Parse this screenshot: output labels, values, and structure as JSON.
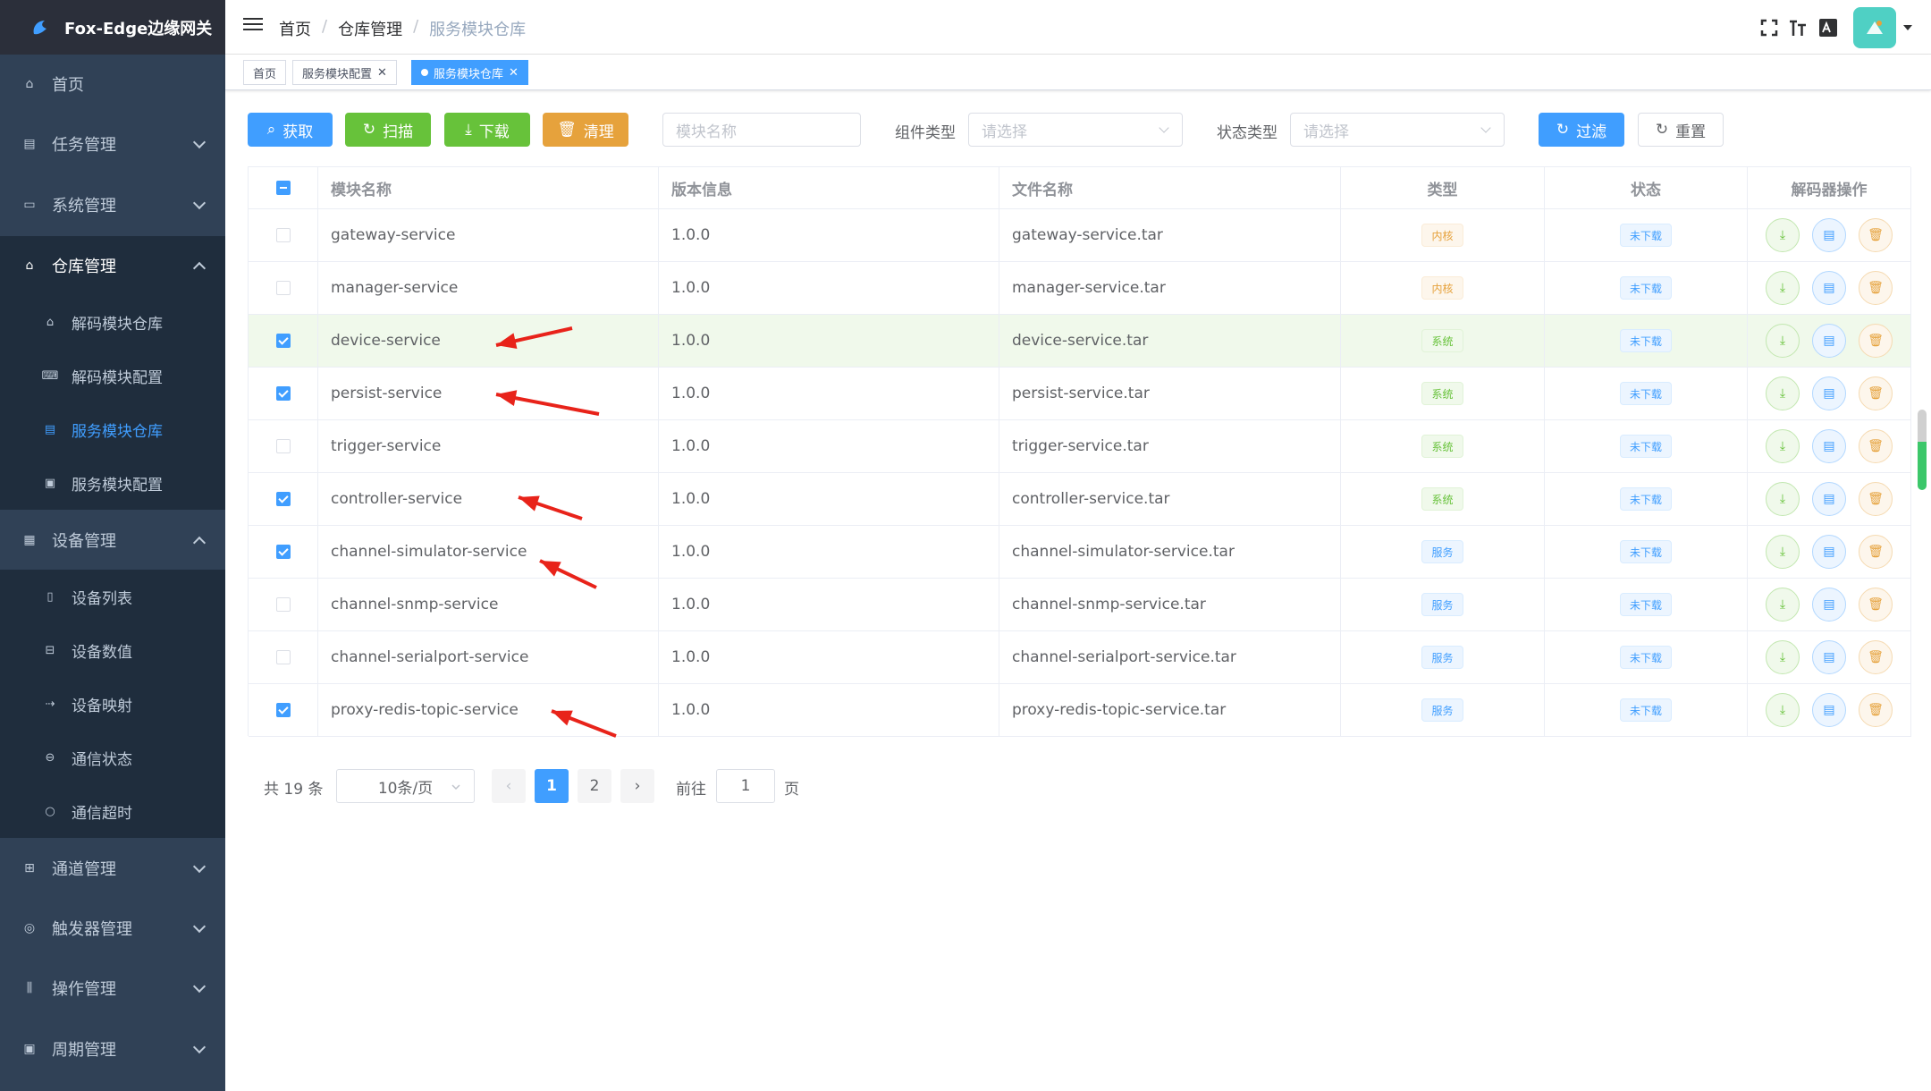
{
  "app": {
    "title": "Fox-Edge边缘网关"
  },
  "sidebar": {
    "items": [
      {
        "label": "首页",
        "icon": "home-icon"
      },
      {
        "label": "任务管理",
        "icon": "task-icon"
      },
      {
        "label": "系统管理",
        "icon": "system-icon"
      },
      {
        "label": "仓库管理",
        "icon": "repo-icon"
      },
      {
        "label": "设备管理",
        "icon": "device-icon"
      },
      {
        "label": "通道管理",
        "icon": "channel-icon"
      },
      {
        "label": "触发器管理",
        "icon": "trigger-icon"
      },
      {
        "label": "操作管理",
        "icon": "operate-icon"
      },
      {
        "label": "周期管理",
        "icon": "period-icon"
      }
    ],
    "repo_sub": [
      {
        "label": "解码模块仓库",
        "icon": "home-icon"
      },
      {
        "label": "解码模块配置",
        "icon": "keyboard-icon"
      },
      {
        "label": "服务模块仓库",
        "icon": "document-icon"
      },
      {
        "label": "服务模块配置",
        "icon": "config-icon"
      }
    ],
    "device_sub": [
      {
        "label": "设备列表",
        "icon": "phone-icon"
      },
      {
        "label": "设备数值",
        "icon": "data-icon"
      },
      {
        "label": "设备映射",
        "icon": "mapping-icon"
      },
      {
        "label": "通信状态",
        "icon": "status-icon"
      },
      {
        "label": "通信超时",
        "icon": "timeout-icon"
      }
    ]
  },
  "navbar": {
    "breadcrumb": [
      "首页",
      "仓库管理",
      "服务模块仓库"
    ],
    "tools": [
      "fullscreen-icon",
      "font-size-icon",
      "language-icon"
    ]
  },
  "tags": [
    {
      "label": "首页",
      "closable": false,
      "active": false
    },
    {
      "label": "服务模块配置",
      "closable": true,
      "active": false
    },
    {
      "label": "服务模块仓库",
      "closable": true,
      "active": true
    }
  ],
  "toolbar": {
    "fetch_label": "获取",
    "scan_label": "扫描",
    "download_label": "下载",
    "clean_label": "清理",
    "module_name_placeholder": "模块名称",
    "component_type_label": "组件类型",
    "component_type_placeholder": "请选择",
    "status_type_label": "状态类型",
    "status_type_placeholder": "请选择",
    "filter_label": "过滤",
    "reset_label": "重置"
  },
  "table": {
    "columns": [
      "模块名称",
      "版本信息",
      "文件名称",
      "类型",
      "状态",
      "解码器操作"
    ],
    "rows": [
      {
        "checked": false,
        "name": "gateway-service",
        "version": "1.0.0",
        "file": "gateway-service.tar",
        "type": "内核",
        "type_style": "warning",
        "status": "未下载"
      },
      {
        "checked": false,
        "name": "manager-service",
        "version": "1.0.0",
        "file": "manager-service.tar",
        "type": "内核",
        "type_style": "warning",
        "status": "未下载"
      },
      {
        "checked": true,
        "name": "device-service",
        "version": "1.0.0",
        "file": "device-service.tar",
        "type": "系统",
        "type_style": "success",
        "status": "未下载"
      },
      {
        "checked": true,
        "name": "persist-service",
        "version": "1.0.0",
        "file": "persist-service.tar",
        "type": "系统",
        "type_style": "success",
        "status": "未下载"
      },
      {
        "checked": false,
        "name": "trigger-service",
        "version": "1.0.0",
        "file": "trigger-service.tar",
        "type": "系统",
        "type_style": "success",
        "status": "未下载"
      },
      {
        "checked": true,
        "name": "controller-service",
        "version": "1.0.0",
        "file": "controller-service.tar",
        "type": "系统",
        "type_style": "success",
        "status": "未下载"
      },
      {
        "checked": true,
        "name": "channel-simulator-service",
        "version": "1.0.0",
        "file": "channel-simulator-service.tar",
        "type": "服务",
        "type_style": "primary",
        "status": "未下载"
      },
      {
        "checked": false,
        "name": "channel-snmp-service",
        "version": "1.0.0",
        "file": "channel-snmp-service.tar",
        "type": "服务",
        "type_style": "primary",
        "status": "未下载"
      },
      {
        "checked": false,
        "name": "channel-serialport-service",
        "version": "1.0.0",
        "file": "channel-serialport-service.tar",
        "type": "服务",
        "type_style": "primary",
        "status": "未下载"
      },
      {
        "checked": true,
        "name": "proxy-redis-topic-service",
        "version": "1.0.0",
        "file": "proxy-redis-topic-service.tar",
        "type": "服务",
        "type_style": "primary",
        "status": "未下载"
      }
    ]
  },
  "pagination": {
    "total_text": "共 19 条",
    "page_size": "10条/页",
    "pages": [
      "1",
      "2"
    ],
    "current_page": "1",
    "goto_label": "前往",
    "goto_value": "1",
    "page_suffix": "页"
  },
  "colors": {
    "sidebar_bg": "#304156",
    "primary": "#409eff",
    "success": "#67c23a",
    "warning": "#e6a23c",
    "annotation_arrow": "#e8231a"
  }
}
